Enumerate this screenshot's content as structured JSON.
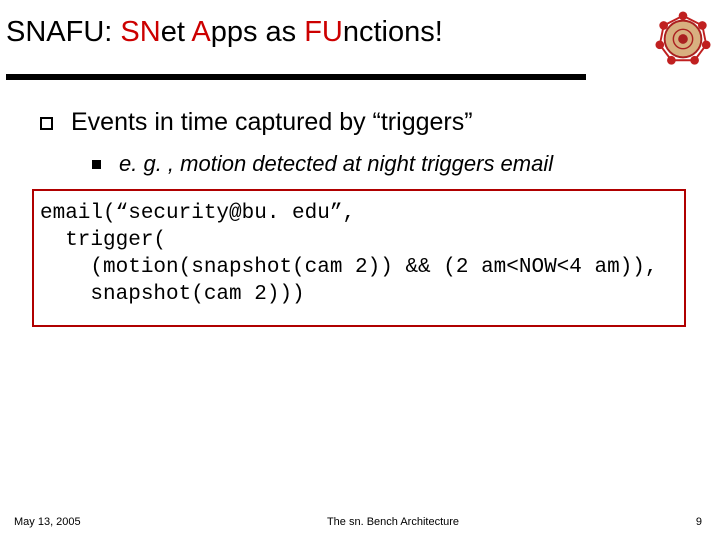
{
  "title": {
    "pre": "SNAFU: ",
    "sn": "SN",
    "mid1": "et ",
    "a": "A",
    "mid2": "pps as ",
    "fu": "FU",
    "post": "nctions!"
  },
  "bullets": {
    "lvl1": "Events in time captured by “triggers”",
    "lvl2": "e. g. , motion detected at night triggers email"
  },
  "code": "email(“security@bu. edu”,\n  trigger(\n    (motion(snapshot(cam 2)) && (2 am<NOW<4 am)),\n    snapshot(cam 2)))",
  "footer": {
    "date": "May 13, 2005",
    "center": "The sn. Bench Architecture",
    "page": "9"
  }
}
